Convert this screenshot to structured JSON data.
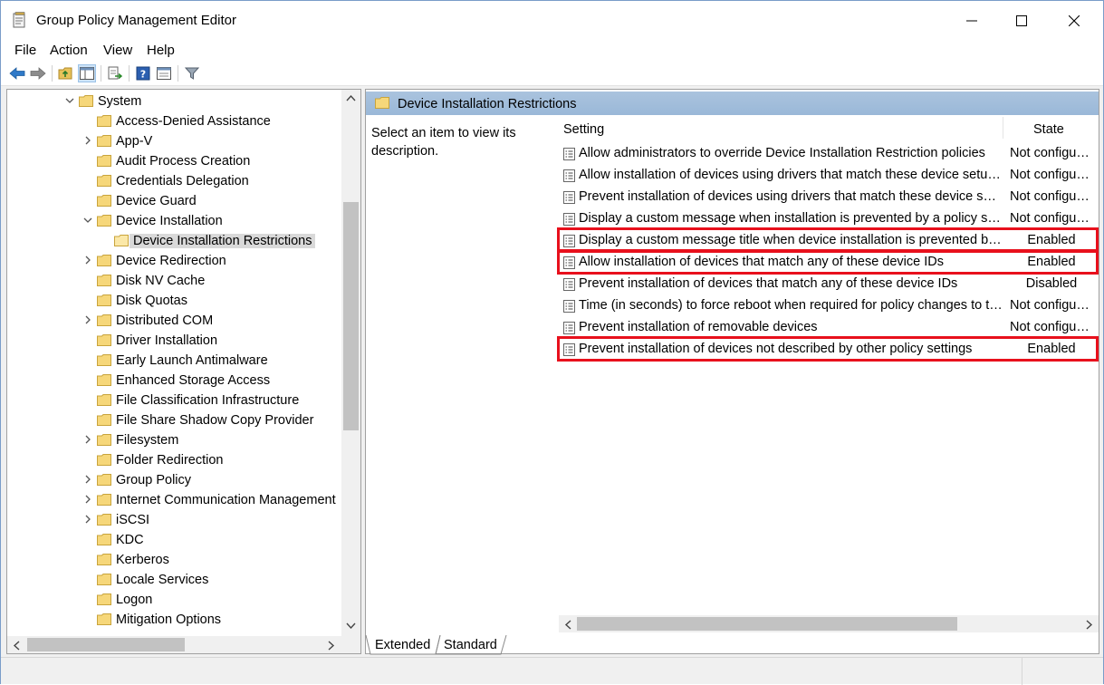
{
  "window": {
    "title": "Group Policy Management Editor"
  },
  "menu": [
    "File",
    "Action",
    "View",
    "Help"
  ],
  "tree": {
    "items": [
      {
        "label": "System",
        "chevron": "down",
        "level": 0
      },
      {
        "label": "Access-Denied Assistance",
        "chevron": "none",
        "level": 1
      },
      {
        "label": "App-V",
        "chevron": "right",
        "level": 1
      },
      {
        "label": "Audit Process Creation",
        "chevron": "none",
        "level": 1
      },
      {
        "label": "Credentials Delegation",
        "chevron": "none",
        "level": 1
      },
      {
        "label": "Device Guard",
        "chevron": "none",
        "level": 1
      },
      {
        "label": "Device Installation",
        "chevron": "down",
        "level": 1
      },
      {
        "label": "Device Installation Restrictions",
        "chevron": "none",
        "level": 2,
        "selected": true
      },
      {
        "label": "Device Redirection",
        "chevron": "right",
        "level": 1
      },
      {
        "label": "Disk NV Cache",
        "chevron": "none",
        "level": 1
      },
      {
        "label": "Disk Quotas",
        "chevron": "none",
        "level": 1
      },
      {
        "label": "Distributed COM",
        "chevron": "right",
        "level": 1
      },
      {
        "label": "Driver Installation",
        "chevron": "none",
        "level": 1
      },
      {
        "label": "Early Launch Antimalware",
        "chevron": "none",
        "level": 1
      },
      {
        "label": "Enhanced Storage Access",
        "chevron": "none",
        "level": 1
      },
      {
        "label": "File Classification Infrastructure",
        "chevron": "none",
        "level": 1
      },
      {
        "label": "File Share Shadow Copy Provider",
        "chevron": "none",
        "level": 1
      },
      {
        "label": "Filesystem",
        "chevron": "right",
        "level": 1
      },
      {
        "label": "Folder Redirection",
        "chevron": "none",
        "level": 1
      },
      {
        "label": "Group Policy",
        "chevron": "right",
        "level": 1
      },
      {
        "label": "Internet Communication Management",
        "chevron": "right",
        "level": 1
      },
      {
        "label": "iSCSI",
        "chevron": "right",
        "level": 1
      },
      {
        "label": "KDC",
        "chevron": "none",
        "level": 1
      },
      {
        "label": "Kerberos",
        "chevron": "none",
        "level": 1
      },
      {
        "label": "Locale Services",
        "chevron": "none",
        "level": 1
      },
      {
        "label": "Logon",
        "chevron": "none",
        "level": 1
      },
      {
        "label": "Mitigation Options",
        "chevron": "none",
        "level": 1
      }
    ]
  },
  "details": {
    "header": "Device Installation Restrictions",
    "description": "Select an item to view its description.",
    "columns": {
      "setting": "Setting",
      "state": "State"
    },
    "rows": [
      {
        "setting": "Allow administrators to override Device Installation Restriction policies",
        "state": "Not configured",
        "highlighted": false
      },
      {
        "setting": "Allow installation of devices using drivers that match these device setup classes",
        "state": "Not configured",
        "highlighted": false
      },
      {
        "setting": "Prevent installation of devices using drivers that match these device setup classes",
        "state": "Not configured",
        "highlighted": false
      },
      {
        "setting": "Display a custom message when installation is prevented by a policy setting",
        "state": "Not configured",
        "highlighted": false
      },
      {
        "setting": "Display a custom message title when device installation is prevented by a policy setting",
        "state": "Enabled",
        "highlighted": true
      },
      {
        "setting": "Allow installation of devices that match any of these device IDs",
        "state": "Enabled",
        "highlighted": true
      },
      {
        "setting": "Prevent installation of devices that match any of these device IDs",
        "state": "Disabled",
        "highlighted": false
      },
      {
        "setting": "Time (in seconds) to force reboot when required for policy changes to take effect",
        "state": "Not configured",
        "highlighted": false
      },
      {
        "setting": "Prevent installation of removable devices",
        "state": "Not configured",
        "highlighted": false
      },
      {
        "setting": "Prevent installation of devices not described by other policy settings",
        "state": "Enabled",
        "highlighted": true
      }
    ]
  },
  "tabs": [
    "Extended",
    "Standard"
  ],
  "colors": {
    "highlight_border": "#e8101c",
    "header_blue": "#9ab8d8",
    "selection": "#d9d9d9"
  }
}
